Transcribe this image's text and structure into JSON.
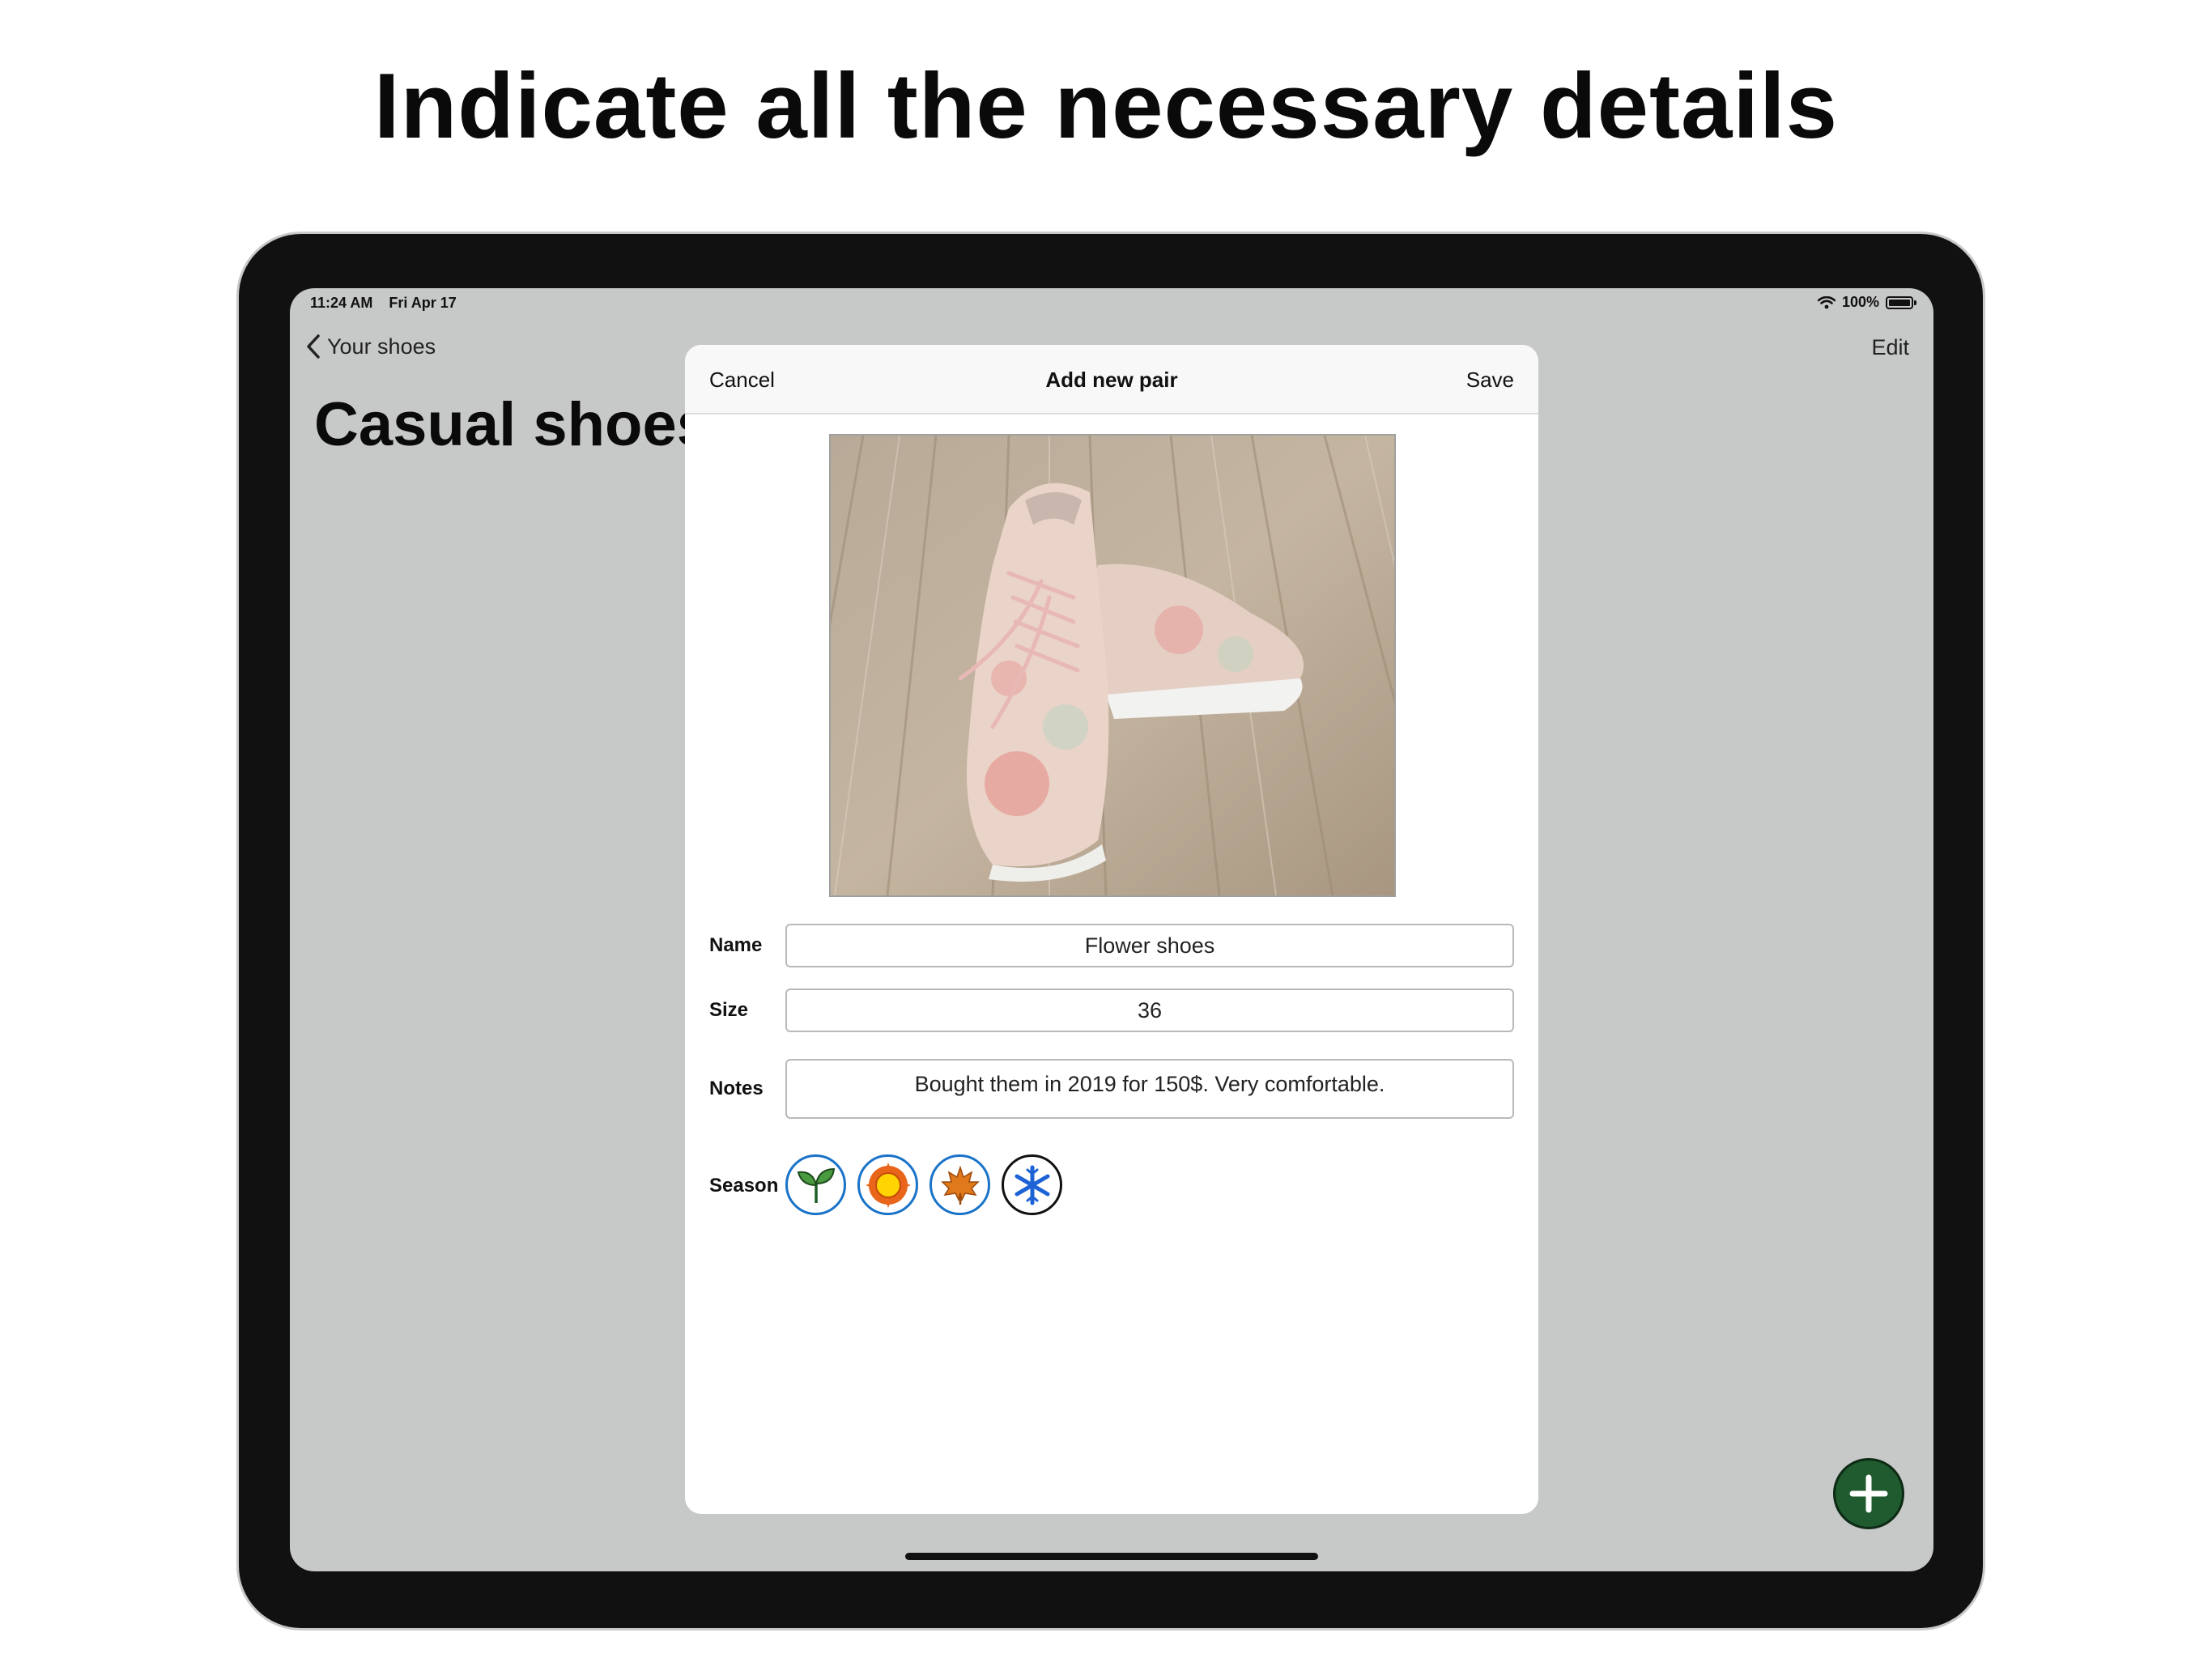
{
  "headline": "Indicate all the necessary details",
  "status_bar": {
    "time": "11:24 AM",
    "date": "Fri Apr 17",
    "battery": "100%"
  },
  "nav": {
    "back_label": "Your shoes",
    "edit_label": "Edit",
    "page_title": "Casual shoes"
  },
  "modal": {
    "cancel_label": "Cancel",
    "title": "Add new pair",
    "save_label": "Save",
    "photo_icon": "shoe-photo",
    "fields": {
      "name_label": "Name",
      "name_value": "Flower shoes",
      "size_label": "Size",
      "size_value": "36",
      "notes_label": "Notes",
      "notes_value": "Bought them in 2019 for 150$. Very comfortable.",
      "season_label": "Season"
    },
    "seasons": [
      {
        "icon": "sprout-icon",
        "selected": true
      },
      {
        "icon": "sun-icon",
        "selected": true
      },
      {
        "icon": "maple-leaf-icon",
        "selected": true
      },
      {
        "icon": "snowflake-icon",
        "selected": false
      }
    ]
  },
  "fab_icon": "plus-icon",
  "colors": {
    "fab": "#1f5b2e",
    "selected_ring": "#1a73c8",
    "unselected_ring": "#111111",
    "backdrop": "#c7c8c8"
  }
}
